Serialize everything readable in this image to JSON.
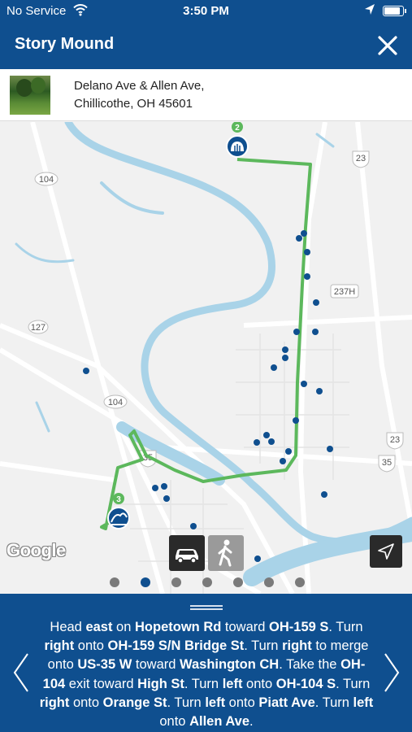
{
  "status_bar": {
    "carrier": "No Service",
    "time": "3:50 PM",
    "battery_level": 0.9
  },
  "header": {
    "title": "Story Mound"
  },
  "address": {
    "line1": "Delano Ave & Allen Ave,",
    "line2": "Chillicothe, OH 45601"
  },
  "map": {
    "google_label": "Google",
    "route_color": "#5cb85c",
    "river_color": "#a9d3e8",
    "marker_color": "#0f4f8f",
    "stops": [
      {
        "number": "2",
        "icon": "mound-icon"
      },
      {
        "number": "3",
        "icon": "earthwork-icon"
      }
    ],
    "road_shields": [
      "23",
      "104",
      "127",
      "237H",
      "104",
      "35",
      "23",
      "35"
    ],
    "modes": [
      "car-icon",
      "walking-person-icon"
    ],
    "active_mode": "car",
    "pager": {
      "count": 7,
      "active_index": 1
    }
  },
  "directions": {
    "segments": [
      {
        "t": "Head ",
        "b": false
      },
      {
        "t": "east",
        "b": true
      },
      {
        "t": " on ",
        "b": false
      },
      {
        "t": "Hopetown Rd",
        "b": true
      },
      {
        "t": " toward ",
        "b": false
      },
      {
        "t": "OH-159 S",
        "b": true
      },
      {
        "t": ". Turn ",
        "b": false
      },
      {
        "t": "right",
        "b": true
      },
      {
        "t": " onto ",
        "b": false
      },
      {
        "t": "OH-159 S/N Bridge St",
        "b": true
      },
      {
        "t": ". Turn ",
        "b": false
      },
      {
        "t": "right",
        "b": true
      },
      {
        "t": " to merge onto ",
        "b": false
      },
      {
        "t": "US-35 W",
        "b": true
      },
      {
        "t": " toward ",
        "b": false
      },
      {
        "t": "Washington CH",
        "b": true
      },
      {
        "t": ". Take the ",
        "b": false
      },
      {
        "t": "OH-104",
        "b": true
      },
      {
        "t": " exit toward ",
        "b": false
      },
      {
        "t": "High St",
        "b": true
      },
      {
        "t": ". Turn ",
        "b": false
      },
      {
        "t": "left",
        "b": true
      },
      {
        "t": " onto ",
        "b": false
      },
      {
        "t": "OH-104 S",
        "b": true
      },
      {
        "t": ". Turn ",
        "b": false
      },
      {
        "t": "right",
        "b": true
      },
      {
        "t": " onto ",
        "b": false
      },
      {
        "t": "Orange St",
        "b": true
      },
      {
        "t": ". Turn ",
        "b": false
      },
      {
        "t": "left",
        "b": true
      },
      {
        "t": " onto ",
        "b": false
      },
      {
        "t": "Piatt Ave",
        "b": true
      },
      {
        "t": ". Turn ",
        "b": false
      },
      {
        "t": "left",
        "b": true
      },
      {
        "t": " onto ",
        "b": false
      },
      {
        "t": "Allen Ave",
        "b": true
      },
      {
        "t": ".",
        "b": false
      }
    ]
  }
}
